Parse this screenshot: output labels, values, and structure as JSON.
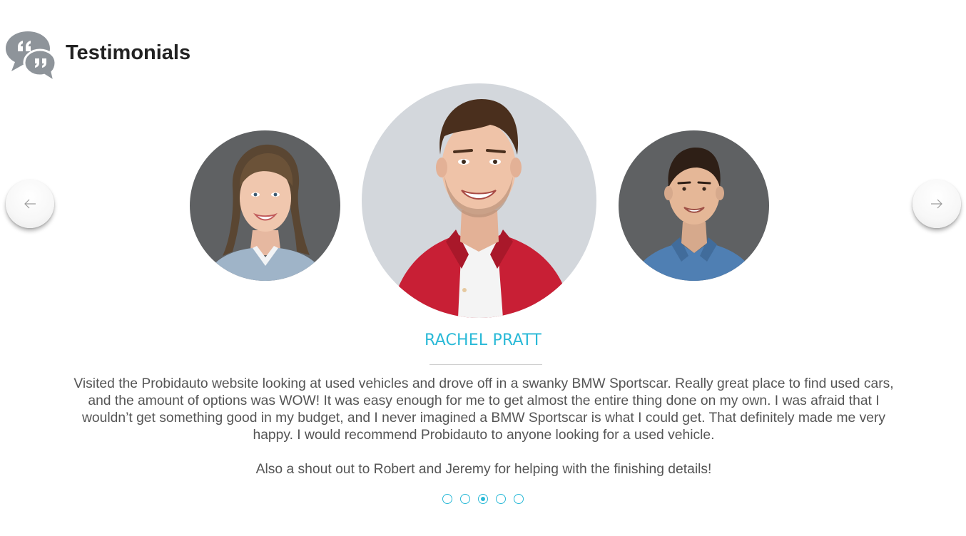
{
  "header": {
    "title": "Testimonials",
    "icon": "speech-bubbles-quote-icon"
  },
  "carousel": {
    "prev_icon": "arrow-left-icon",
    "next_icon": "arrow-right-icon",
    "slides": [
      {
        "position": "left",
        "avatar": "woman-portrait"
      },
      {
        "position": "center",
        "avatar": "man-red-shirt-portrait"
      },
      {
        "position": "right",
        "avatar": "man-blue-shirt-portrait"
      }
    ],
    "active_testimonial": {
      "name": "RACHEL PRATT",
      "paragraphs": [
        "Visited the Probidauto website looking at used vehicles and drove off in a swanky BMW Sportscar. Really great place to find used cars, and the amount of options was WOW!  It was easy enough for me to get almost the entire thing done on my own. I was afraid that I wouldn’t get something good in my budget, and I never imagined a BMW Sportscar is what I could get. That definitely made me very happy. I would recommend Probidauto to anyone looking for a used vehicle.",
        "Also a shout out to Robert and Jeremy for helping with the finishing details!"
      ]
    },
    "pagination": {
      "total": 5,
      "active_index": 2
    }
  },
  "colors": {
    "accent": "#29b9d7",
    "title": "#222222",
    "body_text": "#555555",
    "icon_gray": "#8e949a"
  }
}
